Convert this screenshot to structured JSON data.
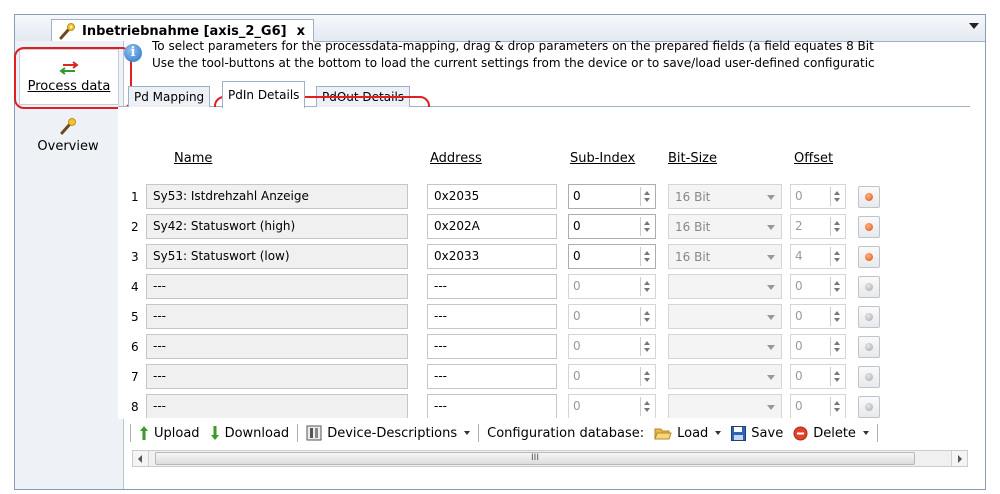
{
  "document_tab": {
    "title": "Inbetriebnahme [axis_2_G6]",
    "close_label": "x"
  },
  "nav": {
    "process_data_label": "Process data",
    "overview_label": "Overview"
  },
  "info": {
    "line1": "To select parameters for the processdata-mapping, drag & drop parameters on the prepared fields (a field equates 8 Bit",
    "line2": "Use the tool-buttons at the bottom to load the current settings from the device or to save/load user-defined configuratic"
  },
  "tabs": [
    {
      "label": "Pd Mapping"
    },
    {
      "label": "PdIn Details"
    },
    {
      "label": "PdOut Details"
    }
  ],
  "table": {
    "headers": {
      "name": "Name",
      "address": "Address",
      "sub_index": "Sub-Index",
      "bit_size": "Bit-Size",
      "offset": "Offset"
    },
    "rows": [
      {
        "num": "1",
        "name": "Sy53: Istdrehzahl Anzeige",
        "address": "0x2035",
        "sub_index": "0",
        "bit_size": "16 Bit",
        "offset": "0"
      },
      {
        "num": "2",
        "name": "Sy42: Statuswort (high)",
        "address": "0x202A",
        "sub_index": "0",
        "bit_size": "16 Bit",
        "offset": "2"
      },
      {
        "num": "3",
        "name": "Sy51: Statuswort (low)",
        "address": "0x2033",
        "sub_index": "0",
        "bit_size": "16 Bit",
        "offset": "4"
      },
      {
        "num": "4",
        "name": "---",
        "address": "---",
        "sub_index": "0",
        "bit_size": "",
        "offset": "0"
      },
      {
        "num": "5",
        "name": "---",
        "address": "---",
        "sub_index": "0",
        "bit_size": "",
        "offset": "0"
      },
      {
        "num": "6",
        "name": "---",
        "address": "---",
        "sub_index": "0",
        "bit_size": "",
        "offset": "0"
      },
      {
        "num": "7",
        "name": "---",
        "address": "---",
        "sub_index": "0",
        "bit_size": "",
        "offset": "0"
      },
      {
        "num": "8",
        "name": "---",
        "address": "---",
        "sub_index": "0",
        "bit_size": "",
        "offset": "0"
      }
    ]
  },
  "toolbar": {
    "upload": "Upload",
    "download": "Download",
    "device_descriptions": "Device-Descriptions",
    "config_db": "Configuration database:",
    "load": "Load",
    "save": "Save",
    "delete": "Delete"
  },
  "scrollbar": {
    "thumb_grip": "III"
  },
  "colors": {
    "highlight": "#e02020",
    "accent_blue": "#2a6fc4",
    "remove_active": "#e2501b"
  }
}
